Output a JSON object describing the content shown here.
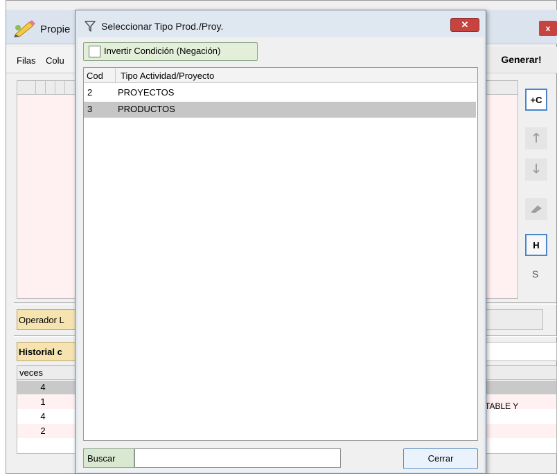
{
  "background_window": {
    "title": "Propie",
    "close_label": "x",
    "tabs": [
      "Filas",
      "Colu"
    ],
    "generate_label": "Generar!",
    "side_buttons": {
      "add_column": "+C",
      "up": "🡑",
      "down": "🡓",
      "h": "H",
      "s": "S"
    },
    "operator_label": "Operador L",
    "history_label": "Historial c",
    "history_header": "veces",
    "history_rows": [
      {
        "veces": "4"
      },
      {
        "veces": "1",
        "text": "TABLE Y"
      },
      {
        "veces": "4"
      },
      {
        "veces": "2"
      }
    ]
  },
  "dialog": {
    "title": "Seleccionar Tipo Prod./Proy.",
    "close_label": "✕",
    "invert_label": "Invertir Condición (Negación)",
    "columns": [
      "Cod",
      "Tipo Actividad/Proyecto"
    ],
    "rows": [
      {
        "cod": "2",
        "tipo": "PROYECTOS",
        "selected": false
      },
      {
        "cod": "3",
        "tipo": "PRODUCTOS",
        "selected": true
      }
    ],
    "search_label": "Buscar",
    "search_value": "",
    "close_button": "Cerrar"
  },
  "colors": {
    "dialog_titlebar": "#dfe7f1",
    "close_red": "#c7433f",
    "selected_row": "#c6c6c6",
    "label_yellow": "#f5e3b0",
    "grid_pink": "#fff1f1"
  },
  "icons": {
    "app": "pencil-app-icon",
    "dialog": "filter-icon",
    "erase": "eraser-icon"
  }
}
